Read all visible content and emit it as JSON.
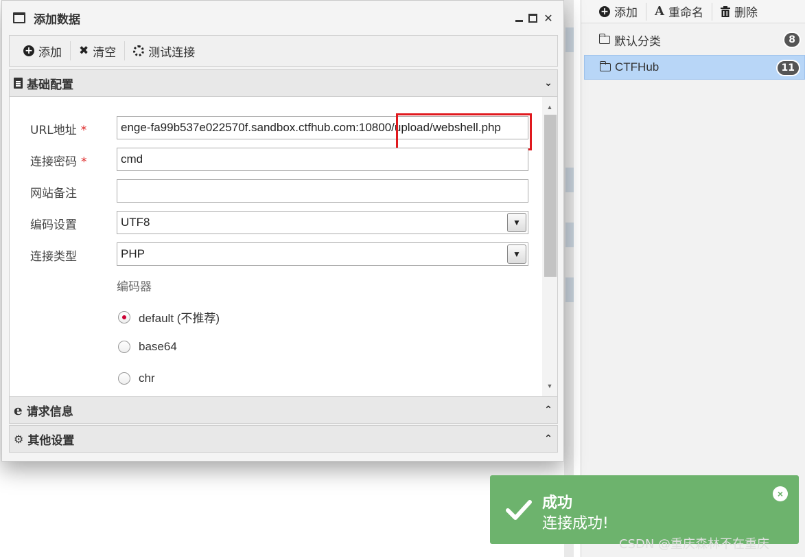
{
  "dialog": {
    "title": "添加数据",
    "controls": {
      "minimize": "_",
      "close": "✕"
    }
  },
  "toolbar": {
    "add_label": "添加",
    "clear_label": "清空",
    "test_label": "测试连接"
  },
  "sections": {
    "basic": "基础配置",
    "request": "请求信息",
    "other": "其他设置"
  },
  "form": {
    "url": {
      "label": "URL地址",
      "required": "*",
      "value": "enge-fa99b537e022570f.sandbox.ctfhub.com:10800/upload/webshell.php"
    },
    "password": {
      "label": "连接密码",
      "required": "*",
      "value": "cmd"
    },
    "note": {
      "label": "网站备注",
      "value": ""
    },
    "encoding": {
      "label": "编码设置",
      "value": "UTF8"
    },
    "type": {
      "label": "连接类型",
      "value": "PHP"
    },
    "encoder": {
      "heading": "编码器",
      "options": [
        "default (不推荐)",
        "base64",
        "chr"
      ],
      "selected": "default (不推荐)"
    }
  },
  "right_panel": {
    "toolbar": {
      "add": "添加",
      "rename": "重命名",
      "delete": "删除"
    },
    "categories": [
      {
        "name": "默认分类",
        "count": "8"
      },
      {
        "name": "CTFHub",
        "count": "11"
      }
    ],
    "active_category": "CTFHub"
  },
  "toast": {
    "title": "成功",
    "message": "连接成功!",
    "close": "×"
  },
  "watermark": "CSDN @重庆森林不在重庆",
  "colors": {
    "toast_bg": "#6db36d",
    "highlight_box": "#e0191e",
    "active_category_bg": "#b8d6f7",
    "required_star": "#d22222"
  }
}
